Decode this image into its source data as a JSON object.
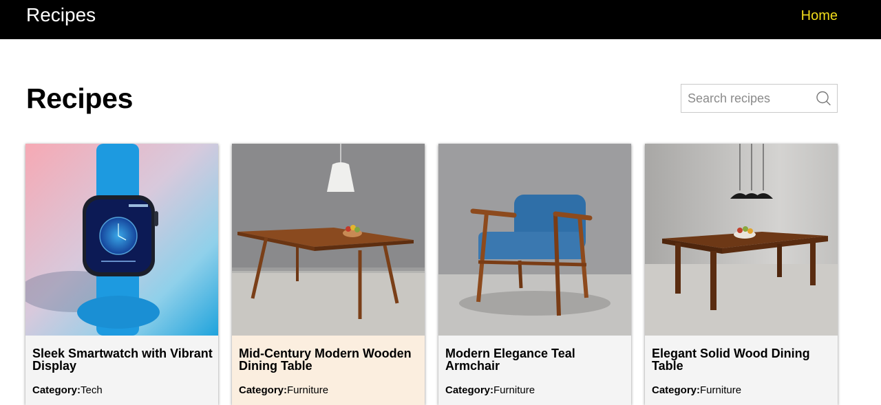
{
  "navbar": {
    "brand": "Recipes",
    "home_label": "Home",
    "link_color": "#f2dd1b"
  },
  "page": {
    "title": "Recipes"
  },
  "search": {
    "placeholder": "Search recipes",
    "value": "",
    "icon": "search-icon"
  },
  "cards": [
    {
      "title": "Sleek Smartwatch with Vibrant Display",
      "category_label": "Category:",
      "category": "Tech",
      "image": "smartwatch-image"
    },
    {
      "title": "Mid-Century Modern Wooden Dining Table",
      "category_label": "Category:",
      "category": "Furniture",
      "image": "mid-century-table-image"
    },
    {
      "title": "Modern Elegance Teal Armchair",
      "category_label": "Category:",
      "category": "Furniture",
      "image": "teal-armchair-image"
    },
    {
      "title": "Elegant Solid Wood Dining Table",
      "category_label": "Category:",
      "category": "Furniture",
      "image": "solid-wood-table-image"
    }
  ]
}
